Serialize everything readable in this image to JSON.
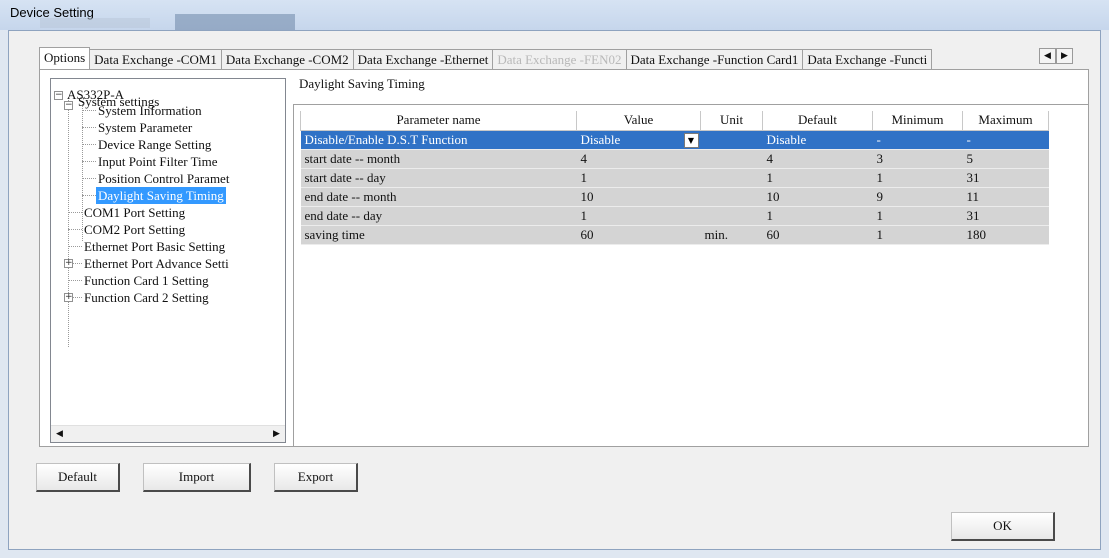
{
  "window": {
    "title": "Device Setting"
  },
  "tabs": [
    {
      "label": "Options",
      "state": "active"
    },
    {
      "label": "Data Exchange -COM1",
      "state": "normal"
    },
    {
      "label": "Data Exchange -COM2",
      "state": "normal"
    },
    {
      "label": "Data Exchange -Ethernet",
      "state": "normal"
    },
    {
      "label": "Data Exchange -FEN02",
      "state": "disabled"
    },
    {
      "label": "Data Exchange -Function Card1",
      "state": "normal"
    },
    {
      "label": "Data Exchange -Functi",
      "state": "normal"
    }
  ],
  "tab_scroll": {
    "left": "◀",
    "right": "▶"
  },
  "tree": {
    "root": "AS332P-A",
    "system_settings": "System settings",
    "children": [
      "System Information",
      "System Parameter",
      "Device Range Setting",
      "Input Point Filter Time",
      "Position Control Paramet",
      "Daylight Saving Timing"
    ],
    "items": [
      "COM1 Port Setting",
      "COM2 Port Setting",
      "Ethernet Port Basic Setting",
      "Ethernet Port Advance Setti",
      "Function Card 1 Setting",
      "Function Card 2 Setting"
    ]
  },
  "section_title": "Daylight Saving Timing",
  "grid": {
    "headers": [
      "Parameter name",
      "Value",
      "Unit",
      "Default",
      "Minimum",
      "Maximum"
    ],
    "rows": [
      {
        "name": "Disable/Enable D.S.T Function",
        "value": "Disable",
        "unit": "",
        "default": "Disable",
        "min": "-",
        "max": "-"
      },
      {
        "name": "start date -- month",
        "value": "4",
        "unit": "",
        "default": "4",
        "min": "3",
        "max": "5"
      },
      {
        "name": "start date -- day",
        "value": "1",
        "unit": "",
        "default": "1",
        "min": "1",
        "max": "31"
      },
      {
        "name": "end date -- month",
        "value": "10",
        "unit": "",
        "default": "10",
        "min": "9",
        "max": "11"
      },
      {
        "name": "end date -- day",
        "value": "1",
        "unit": "",
        "default": "1",
        "min": "1",
        "max": "31"
      },
      {
        "name": "saving time",
        "value": "60",
        "unit": "min.",
        "default": "60",
        "min": "1",
        "max": "180"
      }
    ]
  },
  "buttons": {
    "default": "Default",
    "import": "Import",
    "export": "Export",
    "ok": "OK"
  },
  "colors": {
    "selection": "#3072c6",
    "tree_selection": "#3399ff"
  }
}
